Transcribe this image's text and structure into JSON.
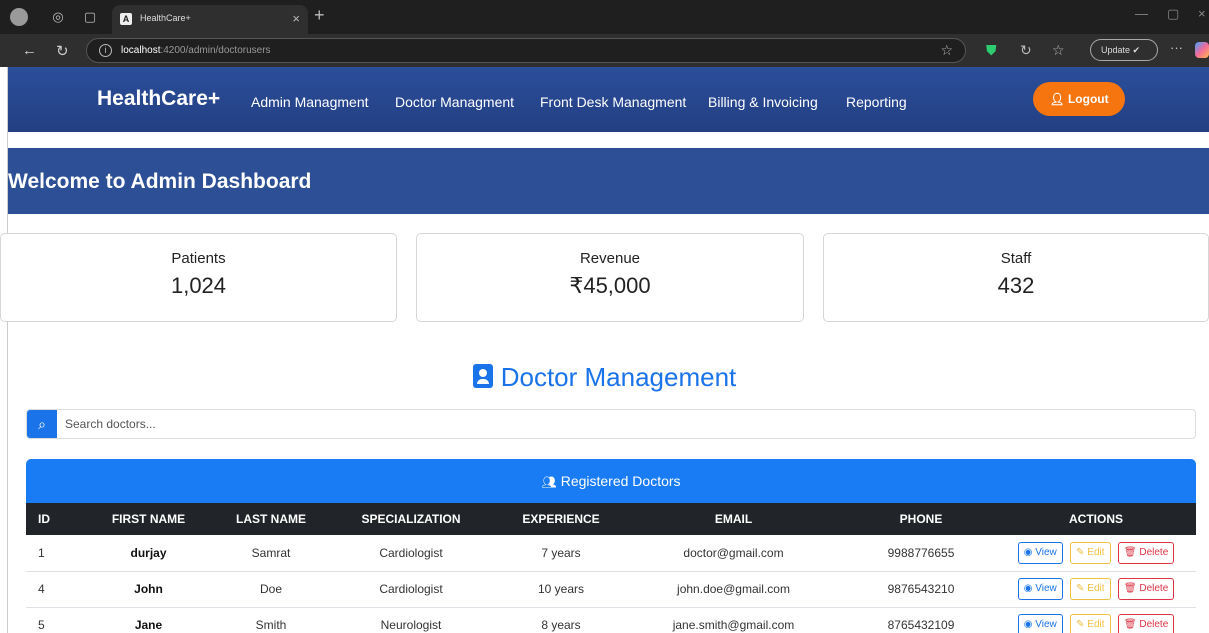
{
  "browser": {
    "tab_title": "HealthCare+",
    "favicon": "A",
    "url_host": "localhost",
    "url_path": ":4200/admin/doctorusers",
    "update_label": "Update"
  },
  "navbar": {
    "brand": "HealthCare+",
    "items": [
      "Admin Managment",
      "Doctor Managment",
      "Front Desk Managment",
      "Billing & Invoicing",
      "Reporting"
    ],
    "logout_label": "Logout",
    "logout_color": "#f7750f"
  },
  "welcome": {
    "title": "Welcome to Admin Dashboard"
  },
  "stats": [
    {
      "label": "Patients",
      "value": "1,024"
    },
    {
      "label": "Revenue",
      "value": "₹45,000"
    },
    {
      "label": "Staff",
      "value": "432"
    }
  ],
  "doctor_management": {
    "title": "Doctor Management",
    "search_placeholder": "Search doctors...",
    "panel_title": "Registered Doctors",
    "columns": [
      "ID",
      "FIRST NAME",
      "LAST NAME",
      "SPECIALIZATION",
      "EXPERIENCE",
      "EMAIL",
      "PHONE",
      "ACTIONS"
    ],
    "rows": [
      {
        "id": "1",
        "first": "durjay",
        "last": "Samrat",
        "spec": "Cardiologist",
        "exp": "7 years",
        "email": "doctor@gmail.com",
        "phone": "9988776655"
      },
      {
        "id": "4",
        "first": "John",
        "last": "Doe",
        "spec": "Cardiologist",
        "exp": "10 years",
        "email": "john.doe@gmail.com",
        "phone": "9876543210"
      },
      {
        "id": "5",
        "first": "Jane",
        "last": "Smith",
        "spec": "Neurologist",
        "exp": "8 years",
        "email": "jane.smith@gmail.com",
        "phone": "8765432109"
      }
    ],
    "actions": {
      "view": "View",
      "edit": "Edit",
      "delete": "Delete"
    },
    "accent_color": "#1a7cf5"
  }
}
